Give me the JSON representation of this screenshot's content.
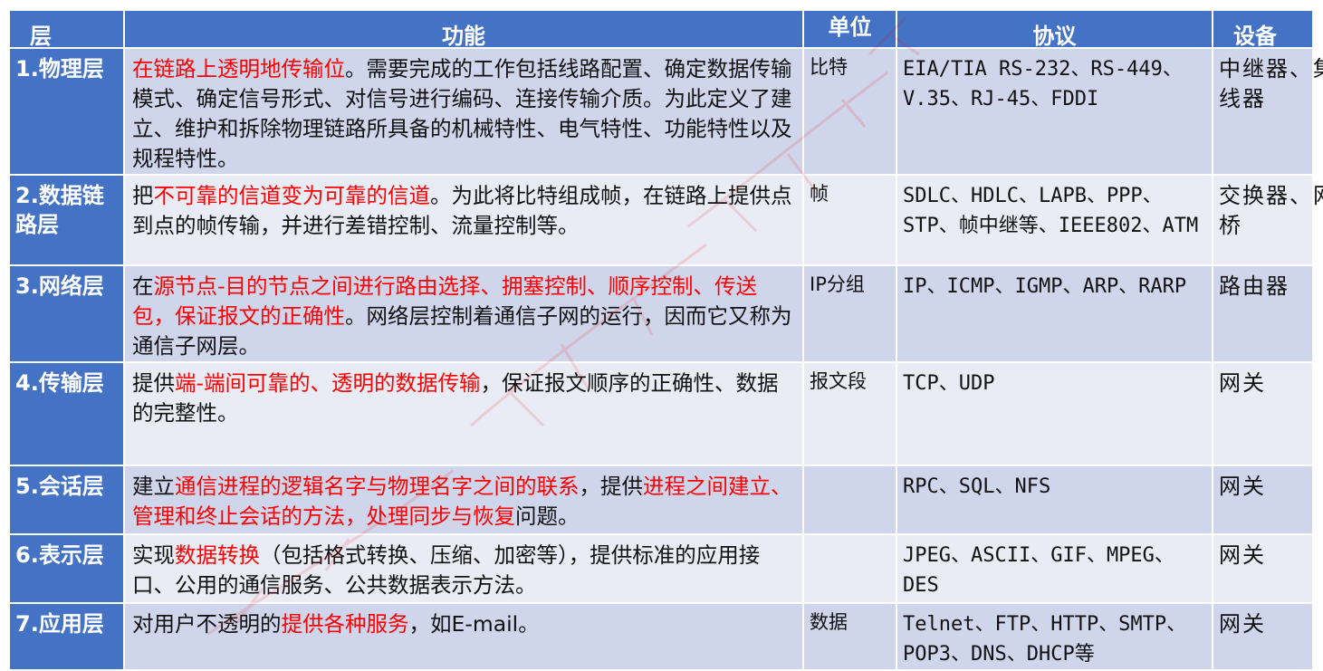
{
  "headers": [
    "层",
    "功能",
    "单位",
    "协议",
    "设备"
  ],
  "rows": [
    {
      "layer": "1.物理层",
      "func": [
        {
          "t": "在链路上透明地传输位",
          "hl": true
        },
        {
          "t": "。需要完成的工作包括线路配置、确定数据传输模式、确定信号形式、对信号进行编码、连接传输介质。为此定义了建立、维护和拆除物理链路所具备的机械特性、电气特性、功能特性以及规程特性。",
          "hl": false
        }
      ],
      "unit": "比特",
      "protocol": "EIA/TIA RS-232、RS-449、V.35、RJ-45、FDDI",
      "device": "中继器、集线器",
      "height": 100
    },
    {
      "layer": "2.数据链路层",
      "func": [
        {
          "t": "把",
          "hl": false
        },
        {
          "t": "不可靠的信道变为可靠的信道",
          "hl": true
        },
        {
          "t": "。为此将比特组成帧，在链路上提供点到点的帧传输，并进行差错控制、流量控制等。",
          "hl": false
        }
      ],
      "unit": "帧",
      "protocol": "SDLC、HDLC、LAPB、PPP、STP、帧中继等、IEEE802、ATM",
      "device": "交换器、网桥",
      "height": 100
    },
    {
      "layer": "3.网络层",
      "func": [
        {
          "t": "在",
          "hl": false
        },
        {
          "t": "源节点-目的节点之间进行路由选择、拥塞控制、顺序控制、传送包，保证报文的正确性",
          "hl": true
        },
        {
          "t": "。网络层控制着通信子网的运行，因而它又称为通信子网层。",
          "hl": false
        }
      ],
      "unit": "IP分组",
      "protocol": "IP、ICMP、IGMP、ARP、RARP",
      "device": "路由器",
      "height": 100
    },
    {
      "layer": "4.传输层",
      "func": [
        {
          "t": "提供",
          "hl": false
        },
        {
          "t": "端-端间可靠的、透明的数据传输",
          "hl": true
        },
        {
          "t": "，保证报文顺序的正确性、数据的完整性。",
          "hl": false
        }
      ],
      "unit": "报文段",
      "protocol": "TCP、UDP",
      "device": "网关",
      "height": 114
    },
    {
      "layer": "5.会话层",
      "func": [
        {
          "t": "建立",
          "hl": false
        },
        {
          "t": "通信进程的逻辑名字与物理名字之间的联系",
          "hl": true
        },
        {
          "t": "，提供",
          "hl": false
        },
        {
          "t": "进程之间建立、管理和终止会话的方法，处理同步与恢复",
          "hl": true
        },
        {
          "t": "问题。",
          "hl": false
        }
      ],
      "unit": "",
      "protocol": "RPC、SQL、NFS",
      "device": "网关",
      "height": 76
    },
    {
      "layer": "6.表示层",
      "func": [
        {
          "t": "实现",
          "hl": false
        },
        {
          "t": "数据转换",
          "hl": true
        },
        {
          "t": "（包括格式转换、压缩、加密等），提供标准的应用接口、公用的通信服务、公共数据表示方法。",
          "hl": false
        }
      ],
      "unit": "",
      "protocol": "JPEG、ASCII、GIF、MPEG、DES",
      "device": "网关",
      "height": 76
    },
    {
      "layer": "7.应用层",
      "func": [
        {
          "t": "对用户不透明的",
          "hl": false
        },
        {
          "t": "提供各种服务",
          "hl": true
        },
        {
          "t": "，如E-mail。",
          "hl": false
        }
      ],
      "unit": "数据",
      "protocol": "Telnet、FTP、HTTP、SMTP、POP3、DNS、DHCP等",
      "device": "网关",
      "height": 66
    }
  ]
}
